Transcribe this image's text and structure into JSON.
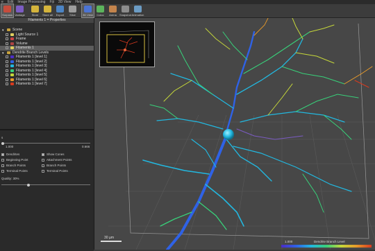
{
  "menubar": {
    "items": [
      "e",
      "Edit",
      "Image Processing",
      "Fiji",
      "3D View",
      "Help"
    ]
  },
  "toolbar": {
    "buttons": [
      {
        "label": "Surpass",
        "color": "#c64c3c",
        "icon": "surpass-icon"
      },
      {
        "label": "Vantage",
        "color": "#7c5cc4",
        "icon": "vantage-icon"
      },
      {
        "label": "Store",
        "color": "#d4b43c",
        "icon": "store-icon"
      },
      {
        "label": "Store all",
        "color": "#d4b43c",
        "icon": "store-all-icon"
      },
      {
        "label": "Export",
        "color": "#4c84c4",
        "icon": "export-icon"
      },
      {
        "label": "Slice",
        "color": "#9c9c9c",
        "icon": "slice-icon"
      },
      {
        "label": "3D View",
        "color": "#4c74d4",
        "icon": "3d-view-icon"
      },
      {
        "label": "Coloc",
        "color": "#5cb45c",
        "icon": "coloc-icon"
      },
      {
        "label": "Arena",
        "color": "#c4844c",
        "icon": "arena-icon"
      },
      {
        "label": "Snapshot",
        "color": "#8c8c8c",
        "icon": "snapshot-icon"
      },
      {
        "label": "Animation",
        "color": "#6c9cc4",
        "icon": "animation-icon"
      }
    ]
  },
  "panel": {
    "title": "Filaments 1 = Properties"
  },
  "tree": [
    {
      "label": "Scene",
      "indent": 0,
      "kind": "folder",
      "color": "#c8a23c"
    },
    {
      "label": "Light Source 1",
      "indent": 1,
      "kind": "check",
      "color": "#e0d060"
    },
    {
      "label": "Frame",
      "indent": 1,
      "kind": "check",
      "color": "#cc4444"
    },
    {
      "label": "Volume",
      "indent": 1,
      "kind": "check",
      "color": "#b04444"
    },
    {
      "label": "Filaments 1",
      "indent": 1,
      "kind": "check",
      "color": "#e0d060",
      "selected": true
    },
    {
      "label": "Dendrite Branch Levels",
      "indent": 0,
      "kind": "folder",
      "color": "#c8a23c"
    },
    {
      "label": "Filaments 1 [level 1]",
      "indent": 1,
      "kind": "check",
      "color": "#4b2cc8"
    },
    {
      "label": "Filaments 1 [level 2]",
      "indent": 1,
      "kind": "check",
      "color": "#2f62e6"
    },
    {
      "label": "Filaments 1 [level 3]",
      "indent": 1,
      "kind": "check",
      "color": "#22b8e0"
    },
    {
      "label": "Filaments 1 [level 4]",
      "indent": 1,
      "kind": "check",
      "color": "#38d17a"
    },
    {
      "label": "Filaments 1 [level 5]",
      "indent": 1,
      "kind": "check",
      "color": "#c6d83a"
    },
    {
      "label": "Filaments 1 [level 6]",
      "indent": 1,
      "kind": "check",
      "color": "#e89a2a"
    },
    {
      "label": "Filaments 1 [level 7]",
      "indent": 1,
      "kind": "check",
      "color": "#d83a1f"
    }
  ],
  "properties": {
    "value_left": "1.000",
    "value_right": "0.666",
    "small_label": "s",
    "checks": [
      {
        "label": "Dendrites",
        "checked": true
      },
      {
        "label": "Show Cones",
        "checked": true
      },
      {
        "label": "Beginning Point",
        "checked": false
      },
      {
        "label": "Attachment Points",
        "checked": false
      },
      {
        "label": "Branch Points",
        "checked": false
      },
      {
        "label": "Branch Points",
        "checked": false
      },
      {
        "label": "Terminal Points",
        "checked": false
      },
      {
        "label": "Terminal Points",
        "checked": false
      }
    ],
    "quality": "Quality: 30%",
    "quality_level": 0.3
  },
  "viewport": {
    "scale_bar": "30 µm",
    "colorbar": {
      "min_label": "1.000",
      "title": "Dendrite Branch Level"
    }
  }
}
